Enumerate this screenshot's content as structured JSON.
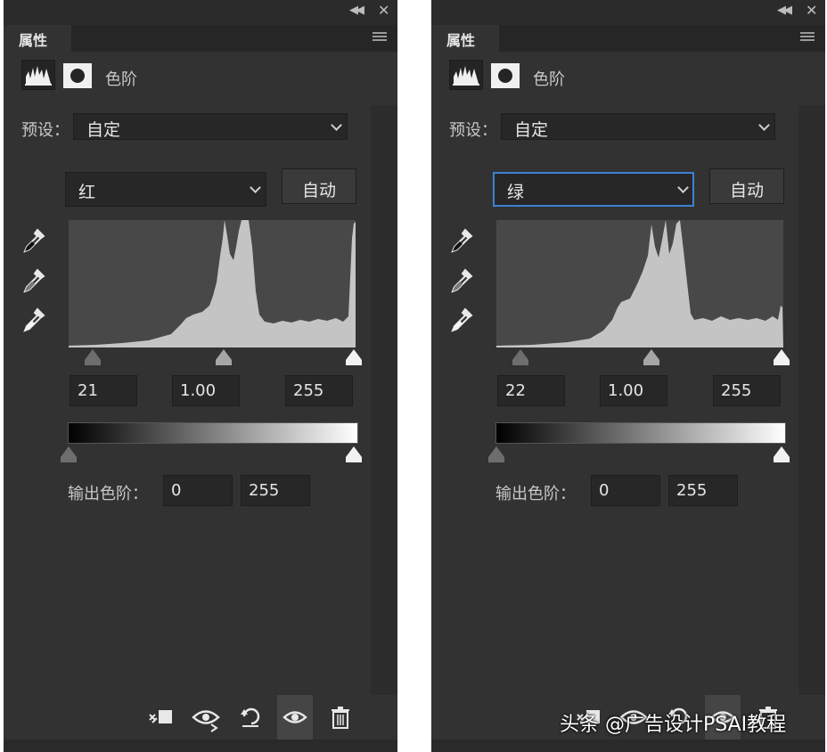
{
  "panels": [
    {
      "tab_title": "属性",
      "adjustment_title": "色阶",
      "preset_label": "预设：",
      "preset_value": "自定",
      "channel_value": "红",
      "channel_focused": false,
      "auto_label": "自动",
      "input_levels": {
        "black": "21",
        "gamma": "1.00",
        "white": "255"
      },
      "output_label": "输出色阶：",
      "output_levels": {
        "black": "0",
        "white": "255"
      }
    },
    {
      "tab_title": "属性",
      "adjustment_title": "色阶",
      "preset_label": "预设：",
      "preset_value": "自定",
      "channel_value": "绿",
      "channel_focused": true,
      "auto_label": "自动",
      "input_levels": {
        "black": "22",
        "gamma": "1.00",
        "white": "255"
      },
      "output_label": "输出色阶：",
      "output_levels": {
        "black": "0",
        "white": "255"
      }
    }
  ],
  "icons": {
    "collapse": "double-chevron-left-icon",
    "close": "close-icon",
    "panel_menu": "panel-menu-icon",
    "levels": "levels-histogram-icon",
    "mask": "layer-mask-icon",
    "eyedroppers": [
      "black-point-eyedropper-icon",
      "gray-point-eyedropper-icon",
      "white-point-eyedropper-icon"
    ],
    "bottom": [
      "clip-to-layer-icon",
      "view-previous-state-icon",
      "reset-icon",
      "visibility-eye-icon",
      "trash-icon"
    ]
  },
  "colors": {
    "panel_bg": "#323232",
    "field_bg": "#272727",
    "focus_border": "#3b82d1",
    "histogram_bg": "#484848",
    "histogram_fill": "#c4c4c4"
  },
  "watermark": "头条 @广告设计PSAI教程"
}
